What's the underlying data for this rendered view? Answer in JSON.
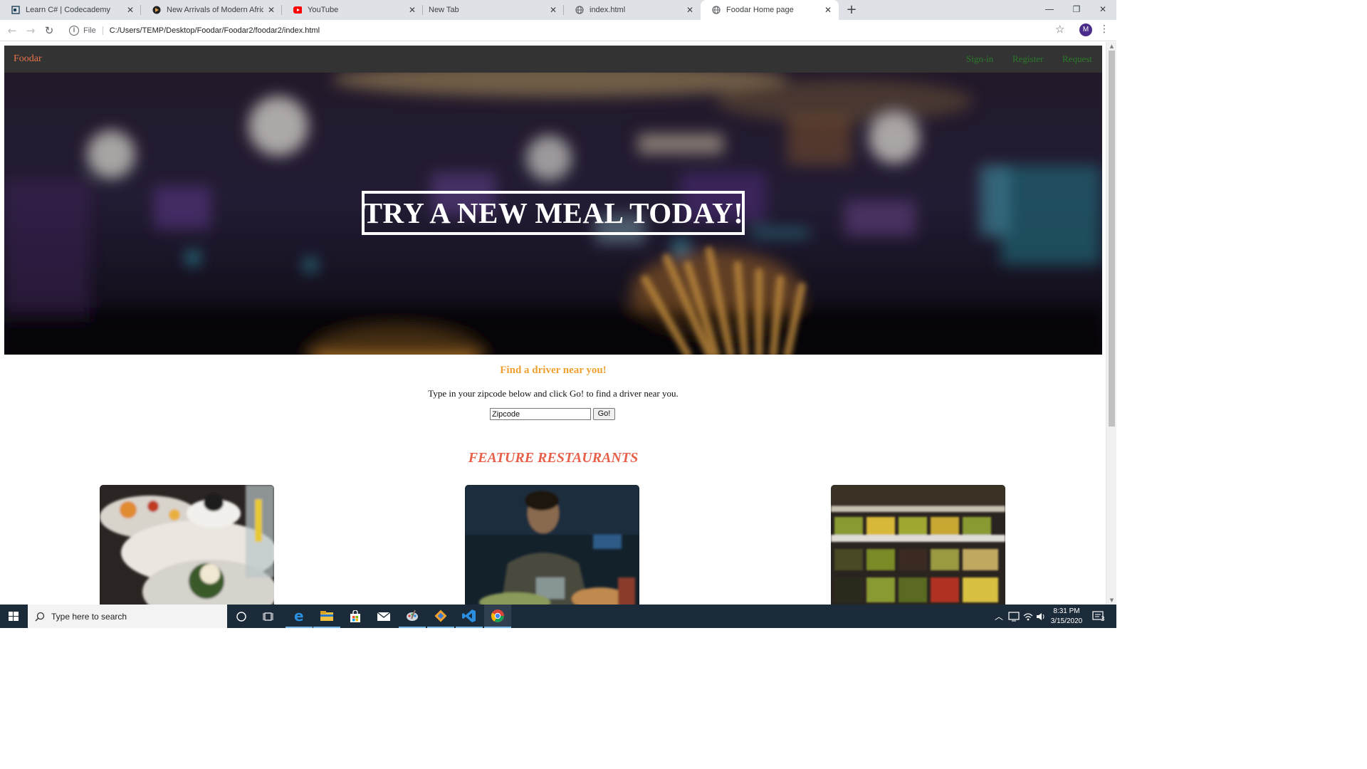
{
  "browser": {
    "tabs": [
      {
        "label": "Learn C# | Codecademy",
        "favicon": "codecademy-icon"
      },
      {
        "label": "New Arrivals of Modern African F",
        "favicon": "shop-icon"
      },
      {
        "label": "YouTube",
        "favicon": "youtube-icon"
      },
      {
        "label": "New Tab",
        "favicon": ""
      },
      {
        "label": "index.html",
        "favicon": "globe-icon"
      },
      {
        "label": "Foodar Home page",
        "favicon": "globe-icon",
        "active": true
      }
    ],
    "scheme_label": "File",
    "url": "C:/Users/TEMP/Desktop/Foodar/Foodar2/foodar2/index.html",
    "profile_initial": "M"
  },
  "site": {
    "brand": "Foodar",
    "nav": [
      "Sign-in",
      "Register",
      "Request"
    ],
    "hero_title": "TRY A NEW MEAL TODAY!",
    "find_title": "Find a driver near you!",
    "find_desc": "Type in your zipcode below and click Go! to find a driver near you.",
    "zip_value": "Zipcode",
    "go_label": "Go!",
    "featured_title": "FEATURE RESTAURANTS",
    "cards": [
      "brunch-plate-photo",
      "diner-man-photo",
      "olive-bar-photo"
    ]
  },
  "taskbar": {
    "search_placeholder": "Type here to search",
    "time": "8:31 PM",
    "date": "3/15/2020",
    "notif_count": "3"
  },
  "colors": {
    "brand": "#e8734a",
    "nav_link": "#2a7a2a",
    "find_title": "#f0a030",
    "featured": "#e8604a"
  }
}
